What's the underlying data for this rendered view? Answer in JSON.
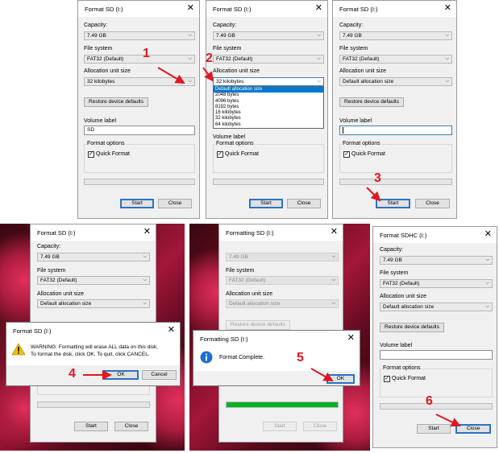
{
  "step_numbers": [
    "1",
    "2",
    "3",
    "4",
    "5",
    "6"
  ],
  "panel1": {
    "title": "Format SD (I:)",
    "capacity_label": "Capacity:",
    "capacity_value": "7.49 GB",
    "fs_label": "File system",
    "fs_value": "FAT32 (Default)",
    "alloc_label": "Allocation unit size",
    "alloc_value": "32 kilobytes",
    "restore_label": "Restore device defaults",
    "volume_label": "Volume label",
    "volume_value": "SD",
    "format_options": "Format options",
    "quick_format": "Quick Format",
    "start": "Start",
    "close": "Close"
  },
  "panel2": {
    "title": "Format SD (I:)",
    "capacity_label": "Capacity:",
    "capacity_value": "7.49 GB",
    "fs_label": "File system",
    "fs_value": "FAT32 (Default)",
    "alloc_label": "Allocation unit size",
    "alloc_value": "32 kilobytes",
    "dropdown_options": [
      "Default allocation size",
      "2048 bytes",
      "4096 bytes",
      "8192 bytes",
      "16 kilobytes",
      "32 kilobytes",
      "64 kilobytes"
    ],
    "volume_label": "Volume label",
    "format_options": "Format options",
    "quick_format": "Quick Format",
    "start": "Start",
    "close": "Close"
  },
  "panel3": {
    "title": "Format SD (I:)",
    "capacity_label": "Capacity:",
    "capacity_value": "7.49 GB",
    "fs_label": "File system",
    "fs_value": "FAT32 (Default)",
    "alloc_label": "Allocation unit size",
    "alloc_value": "Default allocation size",
    "restore_label": "Restore device defaults",
    "volume_label": "Volume label",
    "format_options": "Format options",
    "quick_format": "Quick Format",
    "start": "Start",
    "close": "Close"
  },
  "panel4": {
    "title": "Format SD (I:)",
    "capacity_label": "Capacity:",
    "capacity_value": "7.49 GB",
    "fs_label": "File system",
    "fs_value": "FAT32 (Default)",
    "alloc_label": "Allocation unit size",
    "alloc_value": "Default allocation size",
    "start": "Start",
    "close": "Close",
    "dialog": {
      "title": "Format SD (I:)",
      "message_line1": "WARNING: Formatting will erase ALL data on this disk.",
      "message_line2": "To format the disk, click OK. To quit, click CANCEL.",
      "ok": "OK",
      "cancel": "Cancel"
    }
  },
  "panel5": {
    "title": "Formatting SD (I:)",
    "capacity_value": "7.49 GB",
    "fs_label": "File system",
    "fs_value": "FAT32 (Default)",
    "alloc_label": "Allocation unit size",
    "alloc_value": "Default allocation size",
    "restore_label": "Restore device defaults",
    "start": "Start",
    "close": "Close",
    "progress_fraction": 1.0,
    "dialog": {
      "title": "Formatting SD (I:)",
      "message": "Format Complete.",
      "ok": "OK"
    }
  },
  "panel6": {
    "title": "Format SDHC (I:)",
    "capacity_label": "Capacity:",
    "capacity_value": "7.49 GB",
    "fs_label": "File system",
    "fs_value": "FAT32 (Default)",
    "alloc_label": "Allocation unit size",
    "alloc_value": "Default allocation size",
    "restore_label": "Restore device defaults",
    "volume_label": "Volume label",
    "format_options": "Format options",
    "quick_format": "Quick Format",
    "start": "Start",
    "close": "Close"
  },
  "colors": {
    "step_number": "#e0181e",
    "default_button_border": "#2b73c4",
    "progress": "#06b025"
  }
}
